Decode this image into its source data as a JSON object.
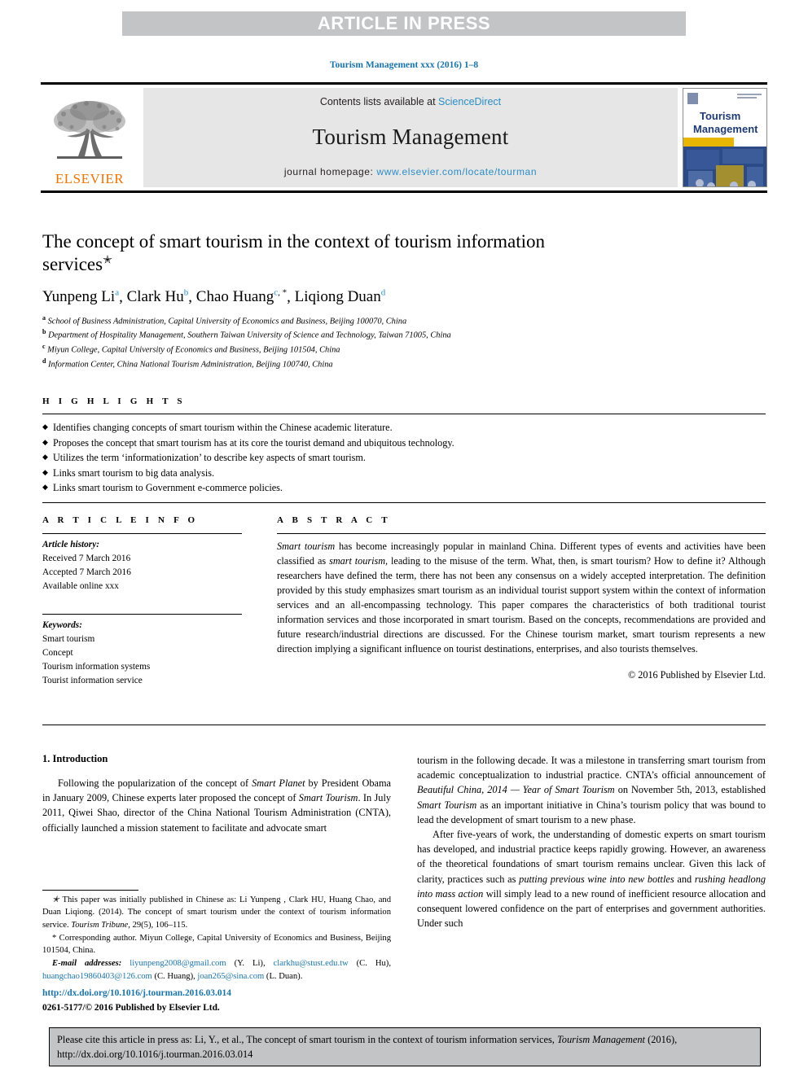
{
  "banner": {
    "label": "ARTICLE IN PRESS"
  },
  "journal_ref": "Tourism Management xxx (2016) 1–8",
  "masthead": {
    "publisher_name": "ELSEVIER",
    "contents_prefix": "Contents lists available at ",
    "contents_link": "ScienceDirect",
    "journal_title": "Tourism Management",
    "homepage_prefix": "journal homepage: ",
    "homepage_url": "www.elsevier.com/locate/tourman",
    "cover": {
      "line1": "Tourism",
      "line2": "Management"
    }
  },
  "article": {
    "title": "The concept of smart tourism in the context of tourism information services",
    "title_mark": "✭",
    "authors": [
      {
        "name": "Yunpeng Li",
        "sup": "a",
        "corr": ""
      },
      {
        "name": "Clark Hu",
        "sup": "b",
        "corr": ""
      },
      {
        "name": "Chao Huang",
        "sup": "c",
        "corr": ", *"
      },
      {
        "name": "Liqiong Duan",
        "sup": "d",
        "corr": ""
      }
    ],
    "affiliations": [
      {
        "mark": "a",
        "text": "School of Business Administration, Capital University of Economics and Business, Beijing 100070, China"
      },
      {
        "mark": "b",
        "text": "Department of Hospitality Management, Southern Taiwan University of Science and Technology, Taiwan 71005, China"
      },
      {
        "mark": "c",
        "text": "Miyun College, Capital University of Economics and Business, Beijing 101504, China"
      },
      {
        "mark": "d",
        "text": "Information Center, China National Tourism Administration, Beijing 100740, China"
      }
    ]
  },
  "highlights": {
    "heading": "H I G H L I G H T S",
    "bullet_glyph": "◆",
    "items": [
      "Identifies changing concepts of smart tourism within the Chinese academic literature.",
      "Proposes the concept that smart tourism has at its core the tourist demand and ubiquitous technology.",
      "Utilizes the term ‘informationization’ to describe key aspects of smart tourism.",
      "Links smart tourism to big data analysis.",
      "Links smart tourism to Government e-commerce policies."
    ]
  },
  "article_info": {
    "heading": "A R T I C L E  I N F O",
    "history_label": "Article history:",
    "history": [
      "Received 7 March 2016",
      "Accepted 7 March 2016",
      "Available online xxx"
    ],
    "keywords_label": "Keywords:",
    "keywords": [
      "Smart tourism",
      "Concept",
      "Tourism information systems",
      "Tourist information service"
    ]
  },
  "abstract": {
    "heading": "A B S T R A C T",
    "paragraph_html": "<em>Smart tourism</em> has become increasingly popular in mainland China. Different types of events and activities have been classified as <em>smart tourism</em>, leading to the misuse of the term. What, then, is smart tourism? How to define it? Although researchers have defined the term, there has not been any consensus on a widely accepted interpretation. The definition provided by this study emphasizes smart tourism as an individual tourist support system within the context of information services and an all-encompassing technology. This paper compares the characteristics of both traditional tourist information services and those incorporated in smart tourism. Based on the concepts, recommendations are provided and future research/industrial directions are discussed. For the Chinese tourism market, smart tourism represents a new direction implying a significant influence on tourist destinations, enterprises, and also tourists themselves.",
    "copyright": "© 2016 Published by Elsevier Ltd."
  },
  "body": {
    "section_heading": "1. Introduction",
    "left_paragraph_html": "Following the popularization of the concept of <em>Smart Planet</em> by President Obama in January 2009, Chinese experts later proposed the concept of <em>Smart Tourism</em>. In July 2011, Qiwei Shao, director of the China National Tourism Administration (CNTA), officially launched a mission statement to facilitate and advocate smart",
    "right_paragraph_1_html": "tourism in the following decade. It was a milestone in transferring smart tourism from academic conceptualization to industrial practice. CNTA’s official announcement of <em>Beautiful China, 2014 — Year of Smart Tourism</em> on November 5th, 2013, established <em>Smart Tourism</em> as an important initiative in China’s tourism policy that was bound to lead the development of smart tourism to a new phase.",
    "right_paragraph_2_html": "After five-years of work, the understanding of domestic experts on smart tourism has developed, and industrial practice keeps rapidly growing. However, an awareness of the theoretical foundations of smart tourism remains unclear. Given this lack of clarity, practices such as <em>putting previous wine into new bottles</em> and <em>rushing headlong into mass action</em> will simply lead to a new round of inefficient resource allocation and consequent lowered confidence on the part of enterprises and government authorities. Under such"
  },
  "footnotes": {
    "star_note_html": "<em>✭</em> This paper was initially published in Chinese as: Li Yunpeng , Clark HU, Huang Chao, and Duan Liqiong. (2014). The concept of smart tourism under the context of tourism information service. <em>Tourism Tribune</em>, 29(5), 106–115.",
    "corr_note": "* Corresponding author. Miyun College, Capital University of Economics and Business, Beijing 101504, China.",
    "email_label": "E-mail addresses:",
    "emails": [
      {
        "address": "liyunpeng2008@gmail.com",
        "owner": "(Y. Li)"
      },
      {
        "address": "clarkhu@stust.edu.tw",
        "owner": "(C. Hu)"
      },
      {
        "address": "huangchao19860403@126.com",
        "owner": "(C. Huang)"
      },
      {
        "address": "joan265@sina.com",
        "owner": "(L. Duan)"
      }
    ]
  },
  "doi": {
    "url": "http://dx.doi.org/10.1016/j.tourman.2016.03.014",
    "issn_line": "0261-5177/© 2016 Published by Elsevier Ltd."
  },
  "cite_footer": {
    "text_html": "Please cite this article in press as: Li, Y., et al., The concept of smart tourism in the context of tourism information services, <em>Tourism Management</em> (2016), http://dx.doi.org/10.1016/j.tourman.2016.03.014"
  },
  "colors": {
    "link_blue": "#2b8dc4",
    "dark_link_blue": "#1b74a8",
    "elsevier_orange": "#ec7404",
    "banner_gray": "#c3c4c6",
    "masthead_gray": "#e6e6e6"
  }
}
